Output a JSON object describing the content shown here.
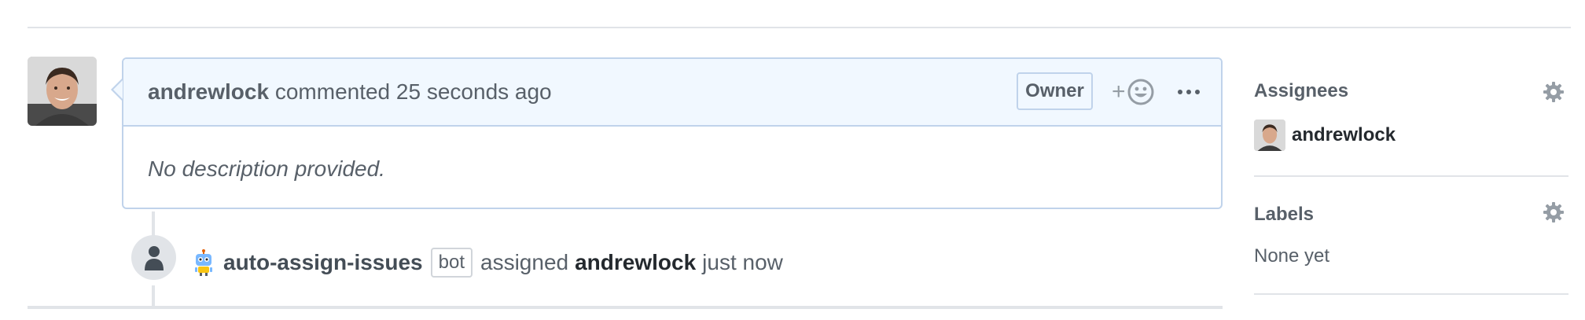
{
  "comment": {
    "author": "andrewlock",
    "action": "commented",
    "time": "25 seconds ago",
    "badge": "Owner",
    "reaction_icon": "smiley-icon",
    "more_icon": "kebab-horizontal-icon",
    "body": "No description provided."
  },
  "event": {
    "icon": "person-icon",
    "actor": "auto-assign-issues",
    "actor_badge": "bot",
    "action": "assigned",
    "assignee": "andrewlock",
    "time": "just now"
  },
  "sidebar": {
    "assignees": {
      "heading": "Assignees",
      "users": [
        {
          "name": "andrewlock"
        }
      ]
    },
    "labels": {
      "heading": "Labels",
      "empty": "None yet"
    }
  },
  "colors": {
    "header_bg": "#f1f8ff",
    "border_blue": "#c0d3eb",
    "muted_text": "#586069",
    "rule": "#e1e4e8"
  }
}
